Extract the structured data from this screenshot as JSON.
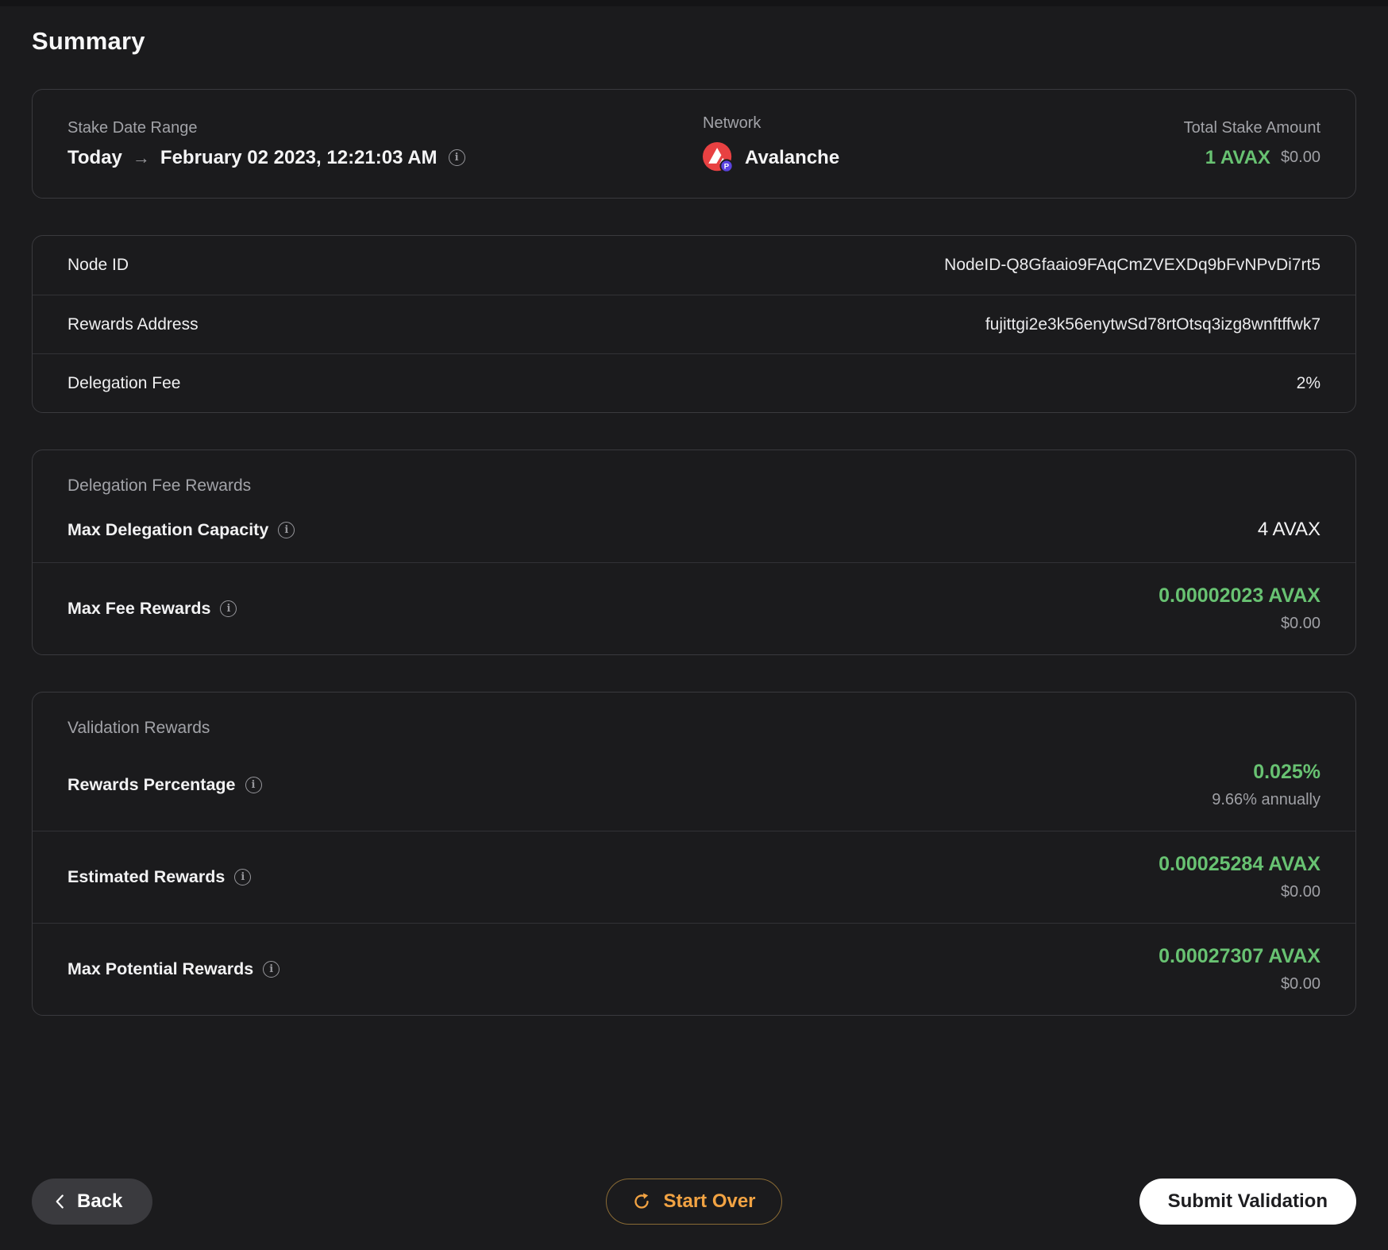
{
  "page": {
    "title": "Summary"
  },
  "colors": {
    "accent_green": "#68c272",
    "accent_orange": "#f2a343",
    "avalanche_red": "#e84142",
    "badge_purple": "#5a43e0"
  },
  "icons": {
    "info": "i"
  },
  "summary_card": {
    "stake_date_range": {
      "label": "Stake Date Range",
      "from": "Today",
      "arrow": "→",
      "to": "February 02 2023, 12:21:03 AM"
    },
    "network": {
      "label": "Network",
      "value": "Avalanche",
      "badge": "P"
    },
    "total_stake": {
      "label": "Total Stake Amount",
      "amount": "1 AVAX",
      "usd": "$0.00"
    }
  },
  "details_table": {
    "rows": [
      {
        "label": "Node ID",
        "value": "NodeID-Q8Gfaaio9FAqCmZVEXDq9bFvNPvDi7rt5"
      },
      {
        "label": "Rewards Address",
        "value": "fujittgi2e3k56enytwSd78rtOtsq3izg8wnftffwk7"
      },
      {
        "label": "Delegation Fee",
        "value": "2%"
      }
    ]
  },
  "delegation_fee_rewards": {
    "title": "Delegation Fee Rewards",
    "max_delegation_capacity": {
      "label": "Max Delegation Capacity",
      "value": "4 AVAX"
    },
    "max_fee_rewards": {
      "label": "Max Fee Rewards",
      "value": "0.00002023 AVAX",
      "usd": "$0.00"
    }
  },
  "validation_rewards": {
    "title": "Validation Rewards",
    "rewards_percentage": {
      "label": "Rewards Percentage",
      "value": "0.025%",
      "sub": "9.66% annually"
    },
    "estimated_rewards": {
      "label": "Estimated Rewards",
      "value": "0.00025284 AVAX",
      "usd": "$0.00"
    },
    "max_potential_rewards": {
      "label": "Max Potential Rewards",
      "value": "0.00027307 AVAX",
      "usd": "$0.00"
    }
  },
  "footer": {
    "back": "Back",
    "start_over": "Start Over",
    "submit": "Submit Validation"
  }
}
